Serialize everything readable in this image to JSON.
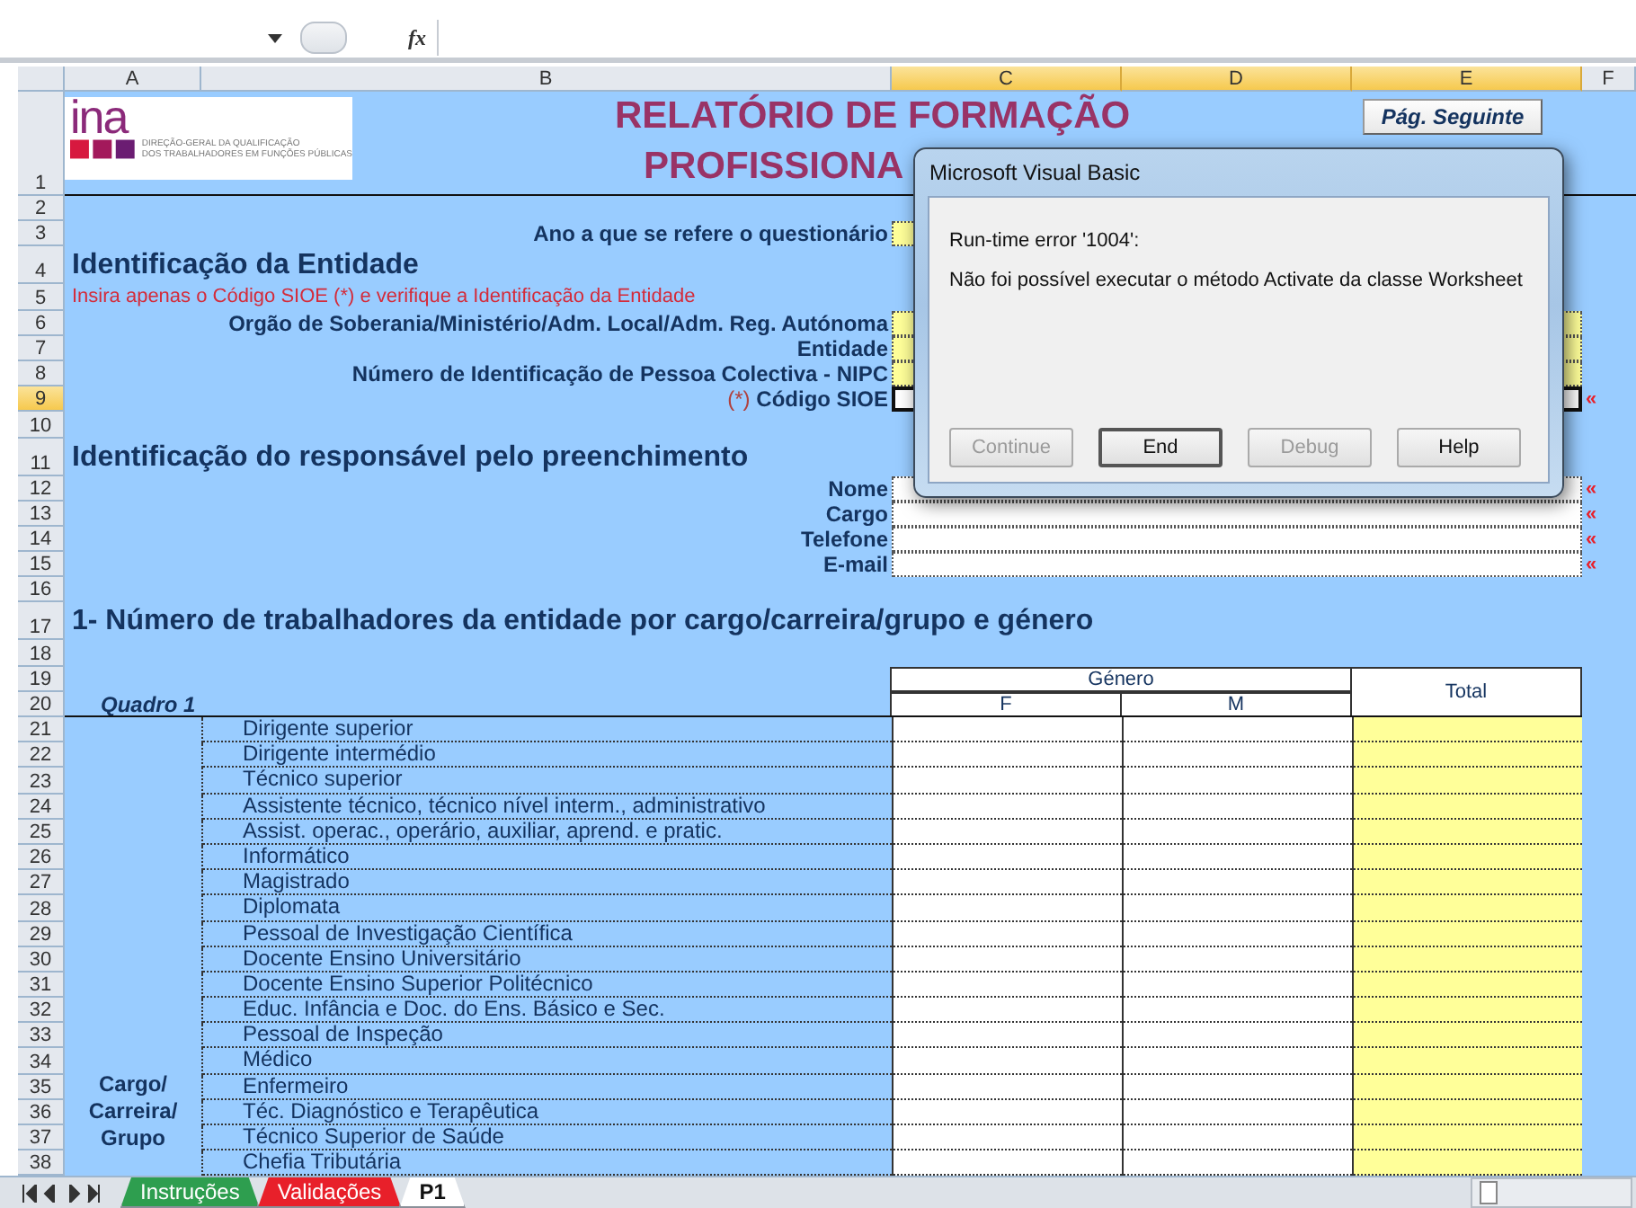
{
  "formula_bar": {
    "fx": "fx"
  },
  "columns": [
    {
      "label": "A",
      "selected": false
    },
    {
      "label": "B",
      "selected": false
    },
    {
      "label": "C",
      "selected": true
    },
    {
      "label": "D",
      "selected": true
    },
    {
      "label": "E",
      "selected": true
    },
    {
      "label": "F",
      "selected": false
    }
  ],
  "rows": [
    {
      "num": "1",
      "kind": "title",
      "selected": false,
      "logo": {
        "mark": "ina",
        "org": [
          "DIREÇÃO-GERAL DA QUALIFICAÇÃO",
          "DOS TRABALHADORES EM FUNÇÕES PÚBLICAS"
        ]
      },
      "title": [
        "RELATÓRIO DE FORMAÇÃO",
        "PROFISSIONA"
      ],
      "button": "Pág. Seguinte"
    },
    {
      "num": "2",
      "kind": "blank",
      "selected": false
    },
    {
      "num": "3",
      "kind": "field",
      "selected": false,
      "label": "Ano a que se refere o questionário",
      "short": true,
      "highlighted": true
    },
    {
      "num": "4",
      "kind": "section",
      "selected": false,
      "text": "Identificação da Entidade"
    },
    {
      "num": "5",
      "kind": "note",
      "selected": false,
      "text": "Insira apenas o Código SIOE (*) e verifique a Identificação da Entidade"
    },
    {
      "num": "6",
      "kind": "field",
      "selected": false,
      "label": "Orgão de Soberania/Ministério/Adm. Local/Adm. Reg. Autónoma",
      "short": false,
      "highlighted": true
    },
    {
      "num": "7",
      "kind": "field",
      "selected": false,
      "label": "Entidade",
      "short": false,
      "highlighted": true
    },
    {
      "num": "8",
      "kind": "field",
      "selected": false,
      "label": "Número de Identificação de Pessoa Colectiva - NIPC",
      "short": false,
      "highlighted": true
    },
    {
      "num": "9",
      "kind": "field",
      "selected": true,
      "prefix": "(*)",
      "label": "Código SIOE",
      "short": false,
      "highlighted": false,
      "marker": "«"
    },
    {
      "num": "10",
      "kind": "blank",
      "selected": false
    },
    {
      "num": "11",
      "kind": "section",
      "selected": false,
      "text": "Identificação do responsável pelo preenchimento"
    },
    {
      "num": "12",
      "kind": "field",
      "selected": false,
      "label": "Nome",
      "short": false,
      "highlighted": false,
      "marker": "«"
    },
    {
      "num": "13",
      "kind": "field",
      "selected": false,
      "label": "Cargo",
      "short": false,
      "highlighted": false,
      "marker": "«"
    },
    {
      "num": "14",
      "kind": "field",
      "selected": false,
      "label": "Telefone",
      "short": false,
      "highlighted": false,
      "marker": "«"
    },
    {
      "num": "15",
      "kind": "field",
      "selected": false,
      "label": "E-mail",
      "short": false,
      "highlighted": false,
      "marker": "«"
    },
    {
      "num": "16",
      "kind": "blank",
      "selected": false
    },
    {
      "num": "17",
      "kind": "section",
      "selected": false,
      "text": "1- Número de trabalhadores da entidade por cargo/carreira/grupo e género"
    },
    {
      "num": "18",
      "kind": "blank",
      "selected": false
    },
    {
      "num": "19",
      "kind": "table_head",
      "selected": false,
      "group": "Género",
      "total": "Total"
    },
    {
      "num": "20",
      "kind": "table_subhead",
      "selected": false,
      "caption": "Quadro 1",
      "columns": [
        "F",
        "M"
      ]
    },
    {
      "num": "21",
      "kind": "data",
      "selected": false,
      "label": "Dirigente superior"
    },
    {
      "num": "22",
      "kind": "data",
      "selected": false,
      "label": "Dirigente intermédio"
    },
    {
      "num": "23",
      "kind": "data",
      "selected": false,
      "label": "Técnico superior"
    },
    {
      "num": "24",
      "kind": "data",
      "selected": false,
      "label": "Assistente técnico, técnico nível interm., administrativo"
    },
    {
      "num": "25",
      "kind": "data",
      "selected": false,
      "label": "Assist. operac., operário, auxiliar, aprend. e pratic."
    },
    {
      "num": "26",
      "kind": "data",
      "selected": false,
      "label": "Informático"
    },
    {
      "num": "27",
      "kind": "data",
      "selected": false,
      "label": "Magistrado"
    },
    {
      "num": "28",
      "kind": "data",
      "selected": false,
      "label": "Diplomata"
    },
    {
      "num": "29",
      "kind": "data",
      "selected": false,
      "label": "Pessoal de Investigação Científica"
    },
    {
      "num": "30",
      "kind": "data",
      "selected": false,
      "label": "Docente Ensino Universitário"
    },
    {
      "num": "31",
      "kind": "data",
      "selected": false,
      "label": "Docente Ensino Superior Politécnico"
    },
    {
      "num": "32",
      "kind": "data",
      "selected": false,
      "label": "Educ. Infância e Doc. do Ens. Básico e Sec."
    },
    {
      "num": "33",
      "kind": "data",
      "selected": false,
      "label": "Pessoal de Inspeção"
    },
    {
      "num": "34",
      "kind": "data",
      "selected": false,
      "label": "Médico"
    },
    {
      "num": "35",
      "kind": "data",
      "selected": false,
      "label": "Enfermeiro",
      "side_label": [
        "Cargo/",
        "Carreira/",
        "Grupo"
      ]
    },
    {
      "num": "36",
      "kind": "data",
      "selected": false,
      "label": "Téc. Diagnóstico e Terapêutica"
    },
    {
      "num": "37",
      "kind": "data",
      "selected": false,
      "label": "Técnico Superior de Saúde"
    },
    {
      "num": "38",
      "kind": "data",
      "selected": false,
      "label": "Chefia Tributária"
    }
  ],
  "sheet_tabs": [
    {
      "label": "Instruções",
      "color": "#2e9e4f",
      "selected": false
    },
    {
      "label": "Validações",
      "color": "#e8202a",
      "selected": false
    },
    {
      "label": "P1",
      "color": "#ffffff",
      "selected": true
    }
  ],
  "dialog": {
    "title": "Microsoft Visual Basic",
    "error": "Run-time error '1004':",
    "message": "Não foi possível executar o método Activate da classe Worksheet",
    "buttons": [
      {
        "label": "Continue",
        "disabled": true,
        "selected": false
      },
      {
        "label": "End",
        "disabled": false,
        "selected": true
      },
      {
        "label": "Debug",
        "disabled": true,
        "selected": false
      },
      {
        "label": "Help",
        "disabled": false,
        "selected": false
      }
    ]
  }
}
